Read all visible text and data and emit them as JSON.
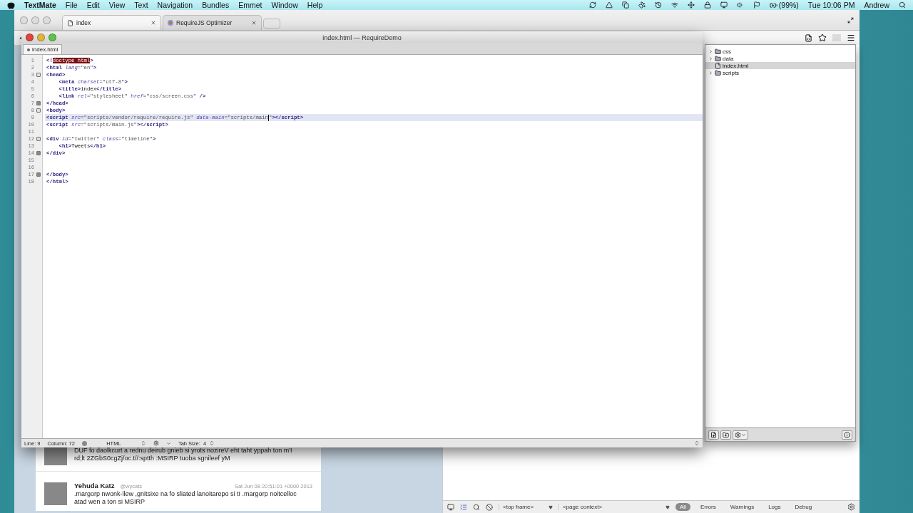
{
  "menu_bar": {
    "app": "TextMate",
    "menus": [
      "File",
      "Edit",
      "View",
      "Text",
      "Navigation",
      "Bundles",
      "Emmet",
      "Window",
      "Help"
    ],
    "battery": "(99%)",
    "clock": "Tue 10:06 PM",
    "user": "Andrew"
  },
  "browser": {
    "tabs": [
      {
        "title": "index",
        "selected": true
      },
      {
        "title": "RequireJS Optimizer",
        "selected": false
      }
    ],
    "tweets": [
      {
        "lines": [
          "DUF fo daolkcurt a rednu deirub gnieb si yrots nozireV eht taht yppah ton m'I",
          "rd;lt 2ZGbS0cgZj/oc.t//:sptth :MSIRP tuoba sgnileef yM"
        ]
      },
      {
        "name": "Yehuda Katz",
        "handle": "@wycats",
        "date": "Sat Jun 08 20:51:01 +0000 2013",
        "lines": [
          ".margorp nwonk-llew ,gnitsixe na fo sliated lanoitarepo si tI .margorp noitcelloc",
          "atad wen a ton si MSIRP"
        ]
      }
    ],
    "devtools": {
      "frame": "<top frame>",
      "context": "<page context>",
      "filters": [
        {
          "label": "All",
          "selected": true
        },
        {
          "label": "Errors",
          "selected": false
        },
        {
          "label": "Warnings",
          "selected": false
        },
        {
          "label": "Logs",
          "selected": false
        },
        {
          "label": "Debug",
          "selected": false
        }
      ]
    }
  },
  "editor": {
    "title": "index.html — RequireDemo",
    "tab": "index.html",
    "lines": [
      {
        "number": "1",
        "kind": "plain",
        "highlighted": false,
        "tokens": [
          {
            "kind": "tag",
            "text": "<!"
          },
          {
            "kind": "selected",
            "text": "doctype html"
          },
          {
            "kind": "tag",
            "text": ">"
          }
        ]
      },
      {
        "number": "2",
        "kind": "plain",
        "highlighted": false,
        "tokens": [
          {
            "kind": "tag",
            "text": "<html "
          },
          {
            "kind": "attr",
            "text": "lang"
          },
          {
            "kind": "string",
            "text": "=\"en\""
          },
          {
            "kind": "tag",
            "text": ">"
          }
        ]
      },
      {
        "number": "3",
        "kind": "opener",
        "highlighted": false,
        "tokens": [
          {
            "kind": "tag",
            "text": "<head>"
          }
        ]
      },
      {
        "number": "4",
        "kind": "plain",
        "highlighted": false,
        "tokens": [
          {
            "kind": "tag",
            "text": "    <meta "
          },
          {
            "kind": "attr",
            "text": "charset"
          },
          {
            "kind": "string",
            "text": "=\"utf-8\""
          },
          {
            "kind": "tag",
            "text": ">"
          }
        ]
      },
      {
        "number": "5",
        "kind": "plain",
        "highlighted": false,
        "tokens": [
          {
            "kind": "tag",
            "text": "    <title>"
          },
          {
            "kind": "text",
            "text": "index"
          },
          {
            "kind": "tag",
            "text": "</title>"
          }
        ]
      },
      {
        "number": "6",
        "kind": "plain",
        "highlighted": false,
        "tokens": [
          {
            "kind": "tag",
            "text": "    <link "
          },
          {
            "kind": "attr",
            "text": "rel"
          },
          {
            "kind": "string",
            "text": "=\"stylesheet\" "
          },
          {
            "kind": "attr",
            "text": "href"
          },
          {
            "kind": "string",
            "text": "=\"css/screen.css\" "
          },
          {
            "kind": "tag",
            "text": "/>"
          }
        ]
      },
      {
        "number": "7",
        "kind": "closer",
        "highlighted": false,
        "tokens": [
          {
            "kind": "tag",
            "text": "</head>"
          }
        ]
      },
      {
        "number": "8",
        "kind": "opener",
        "highlighted": false,
        "tokens": [
          {
            "kind": "tag",
            "text": "<body>"
          }
        ]
      },
      {
        "number": "9",
        "kind": "plain",
        "highlighted": true,
        "tokens": [
          {
            "kind": "tag",
            "text": "<script "
          },
          {
            "kind": "attr",
            "text": "src"
          },
          {
            "kind": "string",
            "text": "=\"scripts/vendor/require/require.js\" "
          },
          {
            "kind": "attr",
            "text": "data-main"
          },
          {
            "kind": "string",
            "text": "=\"scripts/main"
          },
          {
            "kind": "caret"
          },
          {
            "kind": "string",
            "text": "\""
          },
          {
            "kind": "tag",
            "text": "></script>"
          }
        ]
      },
      {
        "number": "10",
        "kind": "plain",
        "highlighted": false,
        "tokens": [
          {
            "kind": "tag",
            "text": "<script "
          },
          {
            "kind": "attr",
            "text": "src"
          },
          {
            "kind": "string",
            "text": "=\"scripts/main.js\""
          },
          {
            "kind": "tag",
            "text": "></script>"
          }
        ]
      },
      {
        "number": "11",
        "kind": "plain",
        "highlighted": false
      },
      {
        "number": "12",
        "kind": "opener",
        "highlighted": false,
        "tokens": [
          {
            "kind": "tag",
            "text": "<div "
          },
          {
            "kind": "attr",
            "text": "id"
          },
          {
            "kind": "string",
            "text": "=\"twitter\" "
          },
          {
            "kind": "attr",
            "text": "class"
          },
          {
            "kind": "string",
            "text": "=\"timeline\""
          },
          {
            "kind": "tag",
            "text": ">"
          }
        ]
      },
      {
        "number": "13",
        "kind": "plain",
        "highlighted": false,
        "tokens": [
          {
            "kind": "tag",
            "text": "    <h1>"
          },
          {
            "kind": "text",
            "text": "Tweets"
          },
          {
            "kind": "tag",
            "text": "</h1>"
          }
        ]
      },
      {
        "number": "14",
        "kind": "closer",
        "highlighted": false,
        "tokens": [
          {
            "kind": "tag",
            "text": "</div>"
          }
        ]
      },
      {
        "number": "15",
        "kind": "plain",
        "highlighted": false
      },
      {
        "number": "16",
        "kind": "plain",
        "highlighted": false
      },
      {
        "number": "17",
        "kind": "closer",
        "highlighted": false,
        "tokens": [
          {
            "kind": "tag",
            "text": "</body>"
          }
        ]
      },
      {
        "number": "18",
        "kind": "plain",
        "highlighted": false,
        "tokens": [
          {
            "kind": "tag",
            "text": "</html>"
          }
        ]
      }
    ],
    "status": {
      "line": "Line: 9",
      "column": "Column: 72",
      "grammar": "HTML",
      "tab_size_label": "Tab Size:",
      "tab_size": "4"
    }
  },
  "drawer": {
    "items": [
      {
        "name": "css",
        "kind": "folder",
        "selected": false
      },
      {
        "name": "data",
        "kind": "folder",
        "selected": false
      },
      {
        "name": "index.html",
        "kind": "file",
        "selected": true
      },
      {
        "name": "scripts",
        "kind": "folder",
        "selected": false
      }
    ]
  }
}
